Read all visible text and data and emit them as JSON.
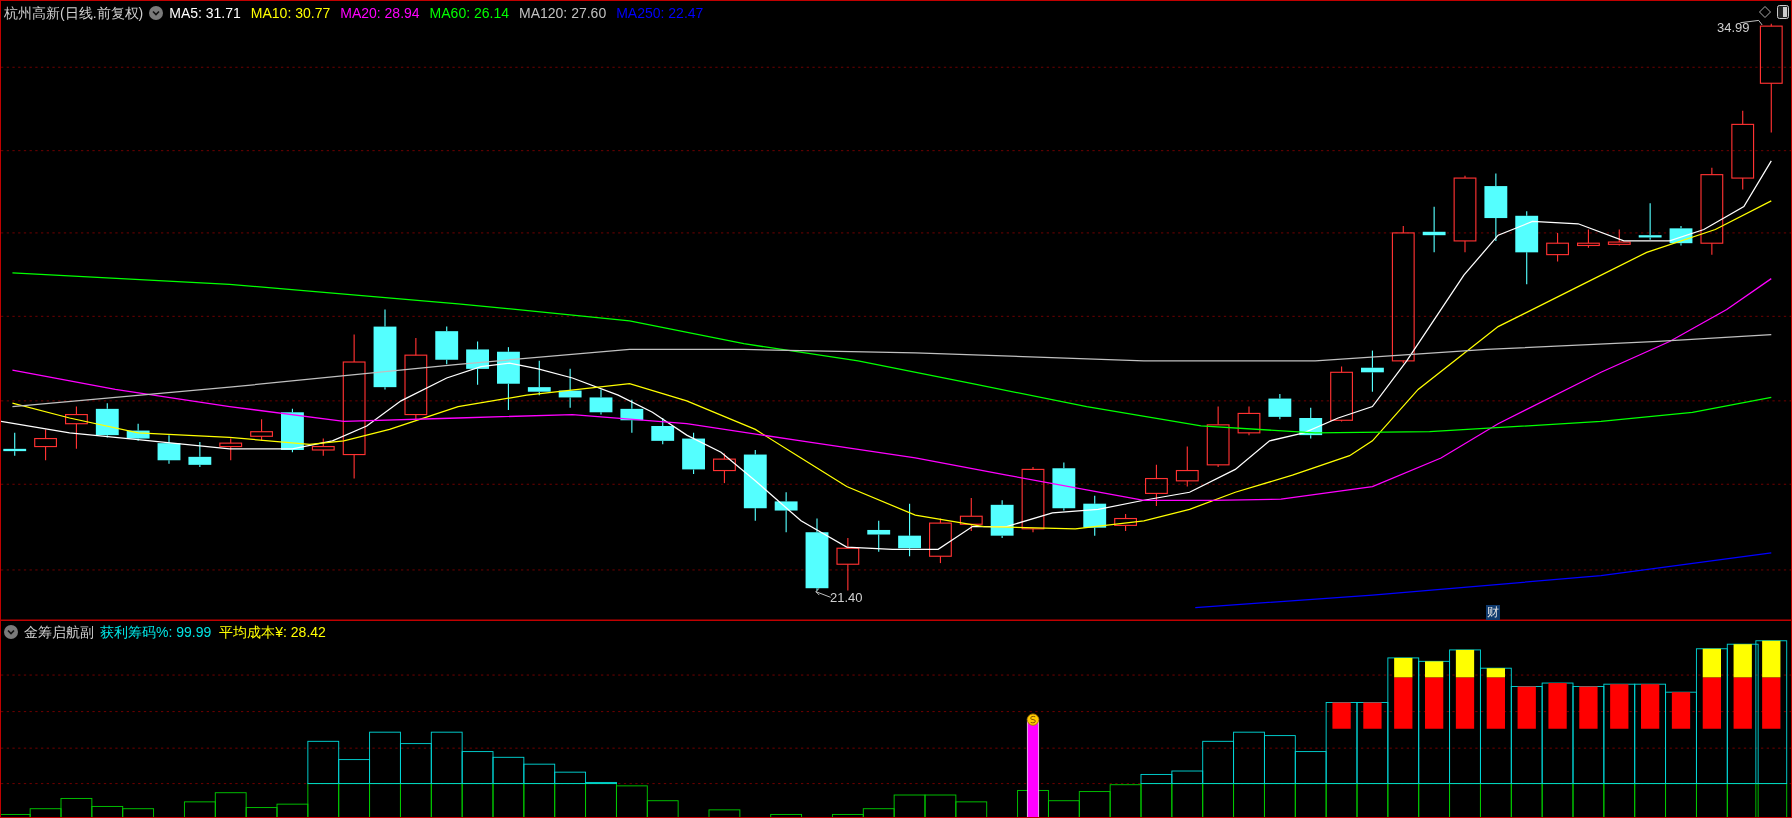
{
  "main_chart": {
    "title": "杭州高新(日线.前复权)",
    "moving_averages": [
      {
        "label": "MA5: 31.71",
        "color": "#ffffff"
      },
      {
        "label": "MA10: 30.77",
        "color": "#ffff00"
      },
      {
        "label": "MA20: 28.94",
        "color": "#ff00ff"
      },
      {
        "label": "MA60: 26.14",
        "color": "#00ff00"
      },
      {
        "label": "MA120: 27.60",
        "color": "#c0c0c0"
      },
      {
        "label": "MA250: 22.47",
        "color": "#0000ff"
      }
    ],
    "high_label": "34.99",
    "low_label": "21.40",
    "badge": "财"
  },
  "indicator": {
    "title": "金筹启航副",
    "values": [
      {
        "label": "获利筹码%: 99.99",
        "color": "#00e5e5"
      },
      {
        "label": "平均成本¥: 28.42",
        "color": "#ffff00"
      }
    ]
  }
}
